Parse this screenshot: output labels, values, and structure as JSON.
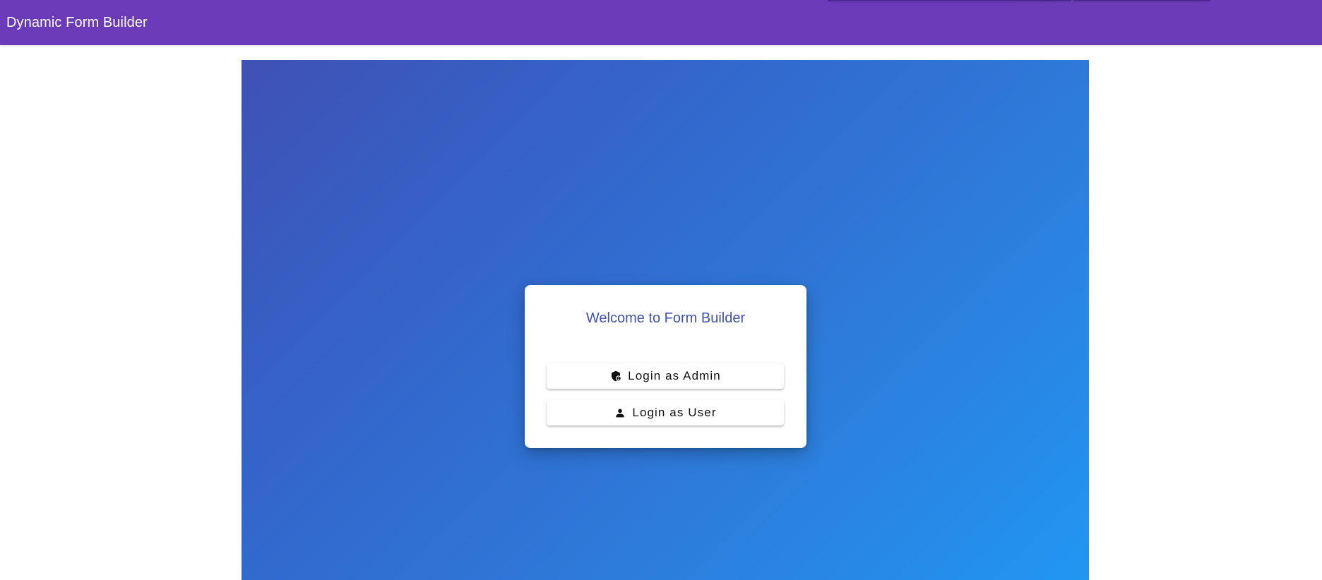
{
  "header": {
    "title": "Dynamic Form Builder",
    "color": "#673ab7"
  },
  "hero": {
    "gradient_start": "#3f51b5",
    "gradient_end": "#2196f3"
  },
  "card": {
    "title": "Welcome to Form Builder",
    "buttons": [
      {
        "label": "Login as Admin",
        "icon": "admin-shield-icon"
      },
      {
        "label": "Login as User",
        "icon": "person-icon"
      }
    ]
  }
}
